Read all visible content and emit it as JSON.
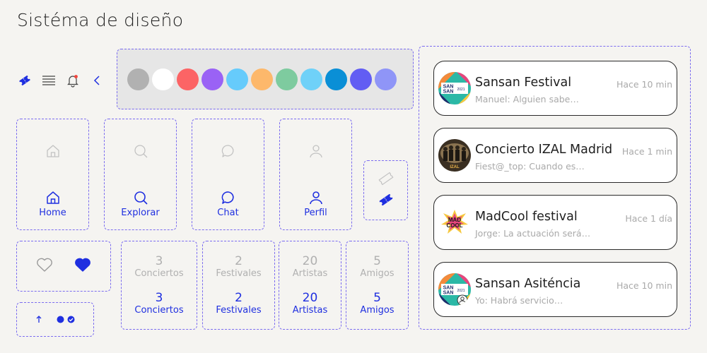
{
  "page": {
    "title": "Sistéma de diseño"
  },
  "toolbar_icons": [
    "ticket-icon",
    "list-icon",
    "bell-notification-icon",
    "chevron-left-icon"
  ],
  "palette": [
    "#b1b1b1",
    "#ffffff",
    "#fc6465",
    "#9a62f5",
    "#66cbfb",
    "#fdb86b",
    "#7ecb9f",
    "#6fd1f8",
    "#0a8fd6",
    "#625df3",
    "#8f95f7"
  ],
  "nav": [
    {
      "label": "Home",
      "icon": "home-icon"
    },
    {
      "label": "Explorar",
      "icon": "search-icon"
    },
    {
      "label": "Chat",
      "icon": "chat-bubble-icon"
    },
    {
      "label": "Perfil",
      "icon": "user-icon"
    }
  ],
  "stats": [
    {
      "value": "3",
      "label": "Conciertos"
    },
    {
      "value": "2",
      "label": "Festivales"
    },
    {
      "value": "20",
      "label": "Artistas"
    },
    {
      "value": "5",
      "label": "Amigos"
    }
  ],
  "chats": [
    {
      "name": "Sansan Festival",
      "message": "Manuel: Alguien sabe…",
      "time": "Hace 10 min"
    },
    {
      "name": "Concierto IZAL Madrid",
      "message": "Fiest@_top: Cuando es…",
      "time": "Hace 1 min"
    },
    {
      "name": "MadCool festival",
      "message": "Jorge: La actuación será…",
      "time": "Hace 1 día"
    },
    {
      "name": "Sansan Asiténcia",
      "message": "Yo: Habrá servicio…",
      "time": "Hace 10 min"
    }
  ],
  "logos": {
    "sansan": {
      "line1": "SAN",
      "line2": "SAN",
      "year": "2021"
    },
    "izal": "IZAL",
    "madcool": {
      "line1": "MAD",
      "line2": "COOL"
    }
  },
  "colors": {
    "accent": "#1f2fe0",
    "muted": "#b0b0b0",
    "dash": "#7b6cf0"
  }
}
